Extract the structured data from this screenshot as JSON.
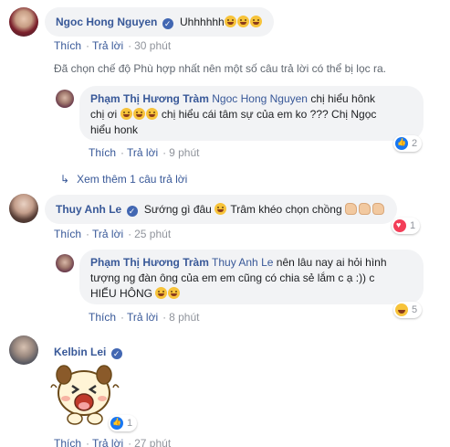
{
  "comments": [
    {
      "author": "Ngoc Hong Nguyen",
      "text": "Uhhhhhh",
      "actions": {
        "like": "Thích",
        "reply": "Trả lời",
        "time": "30 phút"
      }
    },
    {
      "filter_note": "Đã chọn chế độ Phù hợp nhất nên một số câu trả lời có thể bị lọc ra."
    },
    {
      "author": "Phạm Thị Hương Tràm",
      "mention": "Ngoc Hong Nguyen",
      "text_line1": "chị hiểu hônk",
      "text_line2_a": "chị ơi",
      "text_line2_b": "chị hiểu cái tâm sự của em ko ??? Chị Ngọc",
      "text_line3": "hiểu honk",
      "reactions": {
        "count": "2"
      },
      "actions": {
        "like": "Thích",
        "reply": "Trả lời",
        "time": "9 phút"
      }
    },
    {
      "more_replies": "Xem thêm 1 câu trả lời"
    },
    {
      "author": "Thuy Anh Le",
      "text": "Sướng gì đâu",
      "text_b": "Trâm khéo chọn chồng",
      "reactions": {
        "count": "1"
      },
      "actions": {
        "like": "Thích",
        "reply": "Trả lời",
        "time": "25 phút"
      }
    },
    {
      "author": "Phạm Thị Hương Tràm",
      "mention": "Thuy Anh Le",
      "text_line1": "nên lâu nay ai hỏi hình",
      "text_line2": "tượng ng đàn ông của em em cũng có chia sẻ lắm c ạ :)) c",
      "text_line3": "HIỂU HÔNG",
      "reactions": {
        "count": "5"
      },
      "actions": {
        "like": "Thích",
        "reply": "Trả lời",
        "time": "8 phút"
      }
    },
    {
      "author": "Kelbin Lei",
      "reactions": {
        "count": "1"
      },
      "actions": {
        "like": "Thích",
        "reply": "Trả lời",
        "time": "27 phút"
      }
    }
  ],
  "colors": {
    "link": "#385898",
    "bubble": "#f2f3f5",
    "meta": "#90949c"
  }
}
